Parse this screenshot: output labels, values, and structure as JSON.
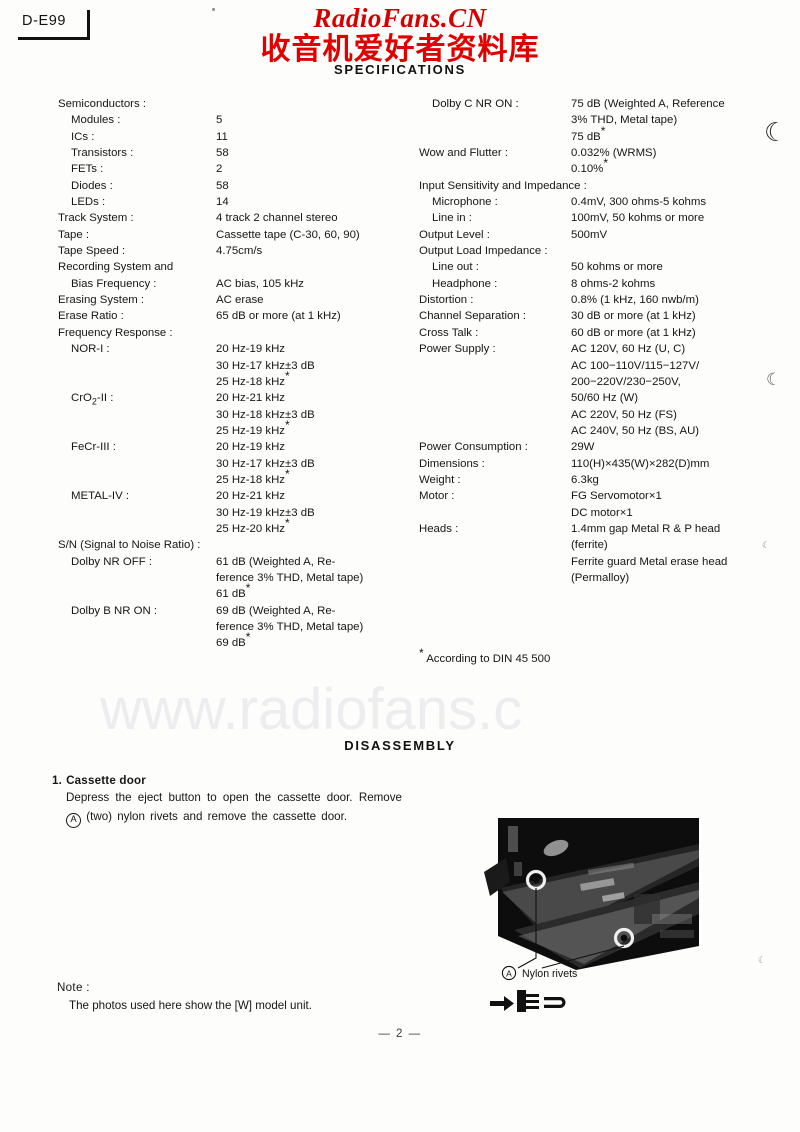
{
  "model_badge": {
    "label": "D-E99"
  },
  "watermark": {
    "latin": "RadioFans.CN",
    "cjk": "收音机爱好者资料库",
    "url": "www.radiofans.c",
    "red_color": "#d40000",
    "gray_color": "#ededf0"
  },
  "headings": {
    "specifications": "SPECIFICATIONS",
    "disassembly": "DISASSEMBLY"
  },
  "spec_left": [
    {
      "key": "Semiconductors :",
      "value": "",
      "indent": 0
    },
    {
      "key": "Modules :",
      "value": "5",
      "indent": 1
    },
    {
      "key": "ICs :",
      "value": "11",
      "indent": 1
    },
    {
      "key": "Transistors :",
      "value": "58",
      "indent": 1
    },
    {
      "key": "FETs :",
      "value": "2",
      "indent": 1
    },
    {
      "key": "Diodes :",
      "value": "58",
      "indent": 1
    },
    {
      "key": "LEDs :",
      "value": "14",
      "indent": 1
    },
    {
      "key": "Track System :",
      "value": "4 track 2 channel stereo",
      "indent": 0
    },
    {
      "key": "Tape :",
      "value": "Cassette tape (C-30, 60, 90)",
      "indent": 0
    },
    {
      "key": "Tape Speed :",
      "value": "4.75cm/s",
      "indent": 0
    },
    {
      "key": "Recording System and",
      "value": "",
      "indent": 0
    },
    {
      "key": "Bias Frequency :",
      "value": "AC bias, 105 kHz",
      "indent": 1
    },
    {
      "key": "Erasing System :",
      "value": "AC erase",
      "indent": 0
    },
    {
      "key": "Erase Ratio :",
      "value": "65 dB or more (at 1 kHz)",
      "indent": 0
    },
    {
      "key": "Frequency Response :",
      "value": "",
      "indent": 0
    },
    {
      "key": "NOR-I :",
      "value": "20 Hz-19 kHz",
      "indent": 1
    },
    {
      "key": "",
      "value": "30 Hz-17 kHz±3 dB",
      "indent": 0
    },
    {
      "key": "",
      "value": "25 Hz-18 kHz*",
      "indent": 0
    },
    {
      "key": "CrO2-II :",
      "value": "20 Hz-21 kHz",
      "indent": 1
    },
    {
      "key": "",
      "value": "30 Hz-18 kHz±3 dB",
      "indent": 0
    },
    {
      "key": "",
      "value": "25 Hz-19 kHz*",
      "indent": 0
    },
    {
      "key": "FeCr-III :",
      "value": "20 Hz-19 kHz",
      "indent": 1
    },
    {
      "key": "",
      "value": "30 Hz-17 kHz±3 dB",
      "indent": 0
    },
    {
      "key": "",
      "value": "25 Hz-18 kHz*",
      "indent": 0
    },
    {
      "key": "METAL-IV :",
      "value": "20 Hz-21 kHz",
      "indent": 1
    },
    {
      "key": "",
      "value": "30 Hz-19 kHz±3 dB",
      "indent": 0
    },
    {
      "key": "",
      "value": "25 Hz-20 kHz*",
      "indent": 0
    },
    {
      "key": "S/N (Signal to Noise Ratio) :",
      "value": "",
      "indent": 0
    },
    {
      "key": "Dolby NR OFF :",
      "value": "61 dB (Weighted A, Re-",
      "indent": 1
    },
    {
      "key": "",
      "value": "ference 3% THD, Metal tape)",
      "indent": 0
    },
    {
      "key": "",
      "value": "61 dB*",
      "indent": 0
    },
    {
      "key": "Dolby B NR ON :",
      "value": "69 dB (Weighted A, Re-",
      "indent": 1
    },
    {
      "key": "",
      "value": "ference 3% THD, Metal tape)",
      "indent": 0
    },
    {
      "key": "",
      "value": "69 dB*",
      "indent": 0
    }
  ],
  "spec_right": [
    {
      "key": "Dolby C NR ON :",
      "value": "75 dB (Weighted A, Reference",
      "indent": 1
    },
    {
      "key": "",
      "value": "3% THD, Metal tape)",
      "indent": 0
    },
    {
      "key": "",
      "value": "75 dB*",
      "indent": 0
    },
    {
      "key": "Wow and Flutter :",
      "value": "0.032% (WRMS)",
      "indent": 0
    },
    {
      "key": "",
      "value": "0.10%*",
      "indent": 0
    },
    {
      "key": "Input Sensitivity and Impedance :",
      "value": "",
      "indent": 0
    },
    {
      "key": "Microphone :",
      "value": "0.4mV, 300 ohms-5 kohms",
      "indent": 1
    },
    {
      "key": "Line in :",
      "value": "100mV, 50 kohms or more",
      "indent": 1
    },
    {
      "key": "Output Level :",
      "value": "500mV",
      "indent": 0
    },
    {
      "key": "Output Load Impedance :",
      "value": "",
      "indent": 0
    },
    {
      "key": "Line out :",
      "value": "50 kohms or more",
      "indent": 1
    },
    {
      "key": "Headphone :",
      "value": "8 ohms-2 kohms",
      "indent": 1
    },
    {
      "key": "Distortion :",
      "value": "0.8% (1 kHz, 160 nwb/m)",
      "indent": 0
    },
    {
      "key": "Channel Separation :",
      "value": "30 dB or more (at 1 kHz)",
      "indent": 0
    },
    {
      "key": "Cross Talk :",
      "value": "60 dB or more (at 1 kHz)",
      "indent": 0
    },
    {
      "key": "Power Supply :",
      "value": "AC 120V, 60 Hz (U, C)",
      "indent": 0
    },
    {
      "key": "",
      "value": "AC 100−110V/115−127V/",
      "indent": 0
    },
    {
      "key": "",
      "value": "200−220V/230−250V,",
      "indent": 0
    },
    {
      "key": "",
      "value": "50/60 Hz (W)",
      "indent": 0
    },
    {
      "key": "",
      "value": "AC 220V, 50 Hz (FS)",
      "indent": 0
    },
    {
      "key": "",
      "value": "AC 240V, 50 Hz (BS, AU)",
      "indent": 0
    },
    {
      "key": "Power Consumption :",
      "value": "29W",
      "indent": 0
    },
    {
      "key": "Dimensions :",
      "value": "110(H)×435(W)×282(D)mm",
      "indent": 0
    },
    {
      "key": "Weight :",
      "value": "6.3kg",
      "indent": 0
    },
    {
      "key": "Motor :",
      "value": "FG Servomotor×1",
      "indent": 0
    },
    {
      "key": "",
      "value": "DC motor×1",
      "indent": 0
    },
    {
      "key": "Heads :",
      "value": "1.4mm gap Metal R & P head",
      "indent": 0
    },
    {
      "key": "",
      "value": "(ferrite)",
      "indent": 0
    },
    {
      "key": "",
      "value": "Ferrite guard Metal erase head",
      "indent": 0
    },
    {
      "key": "",
      "value": "(Permalloy)",
      "indent": 0
    }
  ],
  "footnote": "* According to DIN 45 500",
  "disassembly": {
    "step_number": "1.",
    "step_title": "Cassette door",
    "body_line1": "Depress the eject button to open the cassette door.",
    "body_line2_pre": "Remove",
    "body_circle_mark": "A",
    "body_line2_post": "(two) nylon rivets and remove the cassette",
    "body_line3": "door."
  },
  "figure": {
    "callout_mark": "A",
    "callout_label": "Nylon rivets"
  },
  "note": {
    "label": "Note :",
    "text": "The photos used here show the [W] model unit."
  },
  "page_number": "— 2 —"
}
